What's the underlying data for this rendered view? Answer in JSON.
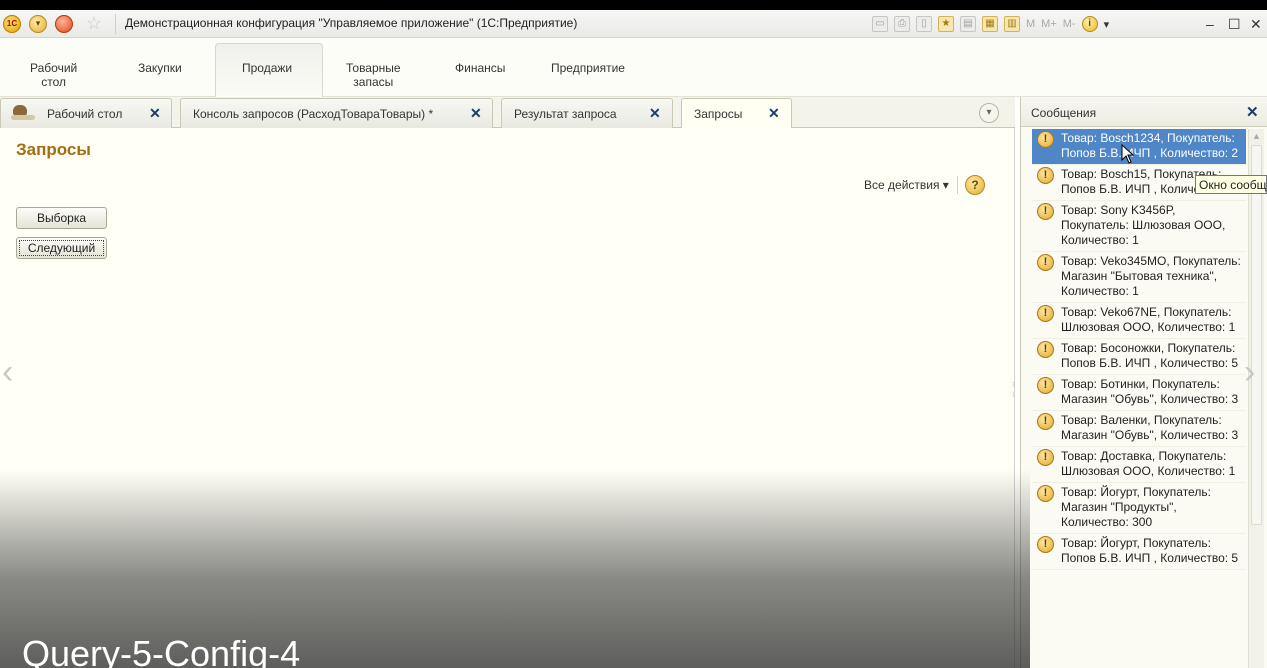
{
  "window": {
    "title": "Демонстрационная конфигурация \"Управляемое приложение\"  (1С:Предприятие)",
    "logo_text": "1С",
    "toolbar_text": [
      "M",
      "M+",
      "M-"
    ]
  },
  "sections": [
    {
      "label": "Рабочий\nстол"
    },
    {
      "label": "Закупки"
    },
    {
      "label": "Продажи"
    },
    {
      "label": "Товарные\nзапасы"
    },
    {
      "label": "Финансы"
    },
    {
      "label": "Предприятие"
    }
  ],
  "tabs": [
    {
      "label": "Рабочий стол"
    },
    {
      "label": "Консоль запросов (РасходТовараТовары) *"
    },
    {
      "label": "Результат запроса"
    },
    {
      "label": "Запросы"
    }
  ],
  "form": {
    "title": "Запросы",
    "all_actions": "Все действия ▾",
    "buttons": {
      "select": "Выборка",
      "next": "Следующий"
    }
  },
  "messages": {
    "title": "Сообщения",
    "tooltip": "Окно сообщений",
    "items": [
      "Товар: Bosch1234, Покупатель: Попов Б.В. ИЧП , Количество: 2",
      "Товар: Bosch15, Покупатель: Попов Б.В. ИЧП , Количество: 3",
      "Товар: Sony K3456P, Покупатель: Шлюзовая ООО, Количество: 1",
      "Товар: Veko345MO, Покупатель: Магазин \"Бытовая техника\", Количество: 1",
      "Товар: Veko67NE, Покупатель: Шлюзовая ООО, Количество: 1",
      "Товар: Босоножки, Покупатель: Попов Б.В. ИЧП , Количество: 5",
      "Товар: Ботинки, Покупатель: Магазин \"Обувь\", Количество: 3",
      "Товар: Валенки, Покупатель: Магазин \"Обувь\", Количество: 3",
      "Товар: Доставка, Покупатель: Шлюзовая ООО, Количество: 1",
      "Товар: Йогурт, Покупатель: Магазин \"Продукты\", Количество: 300",
      "Товар: Йогурт, Покупатель: Попов Б.В. ИЧП , Количество: 5"
    ]
  },
  "caption": "Query-5-Config-4",
  "colors": {
    "accent_title": "#a46d12",
    "selected_row": "#4f86c8",
    "close_x": "#1a3d6b"
  }
}
